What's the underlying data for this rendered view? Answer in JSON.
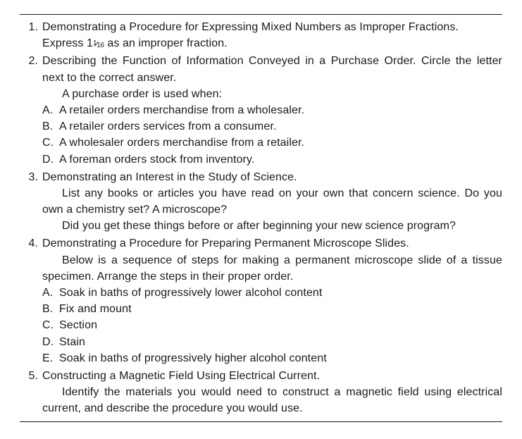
{
  "items": [
    {
      "num": "1.",
      "title": "Demonstrating a Procedure for Expressing Mixed Numbers as Improper Fractions.",
      "lines": [
        "Express 1 1/16 as an improper fraction."
      ],
      "fraction_display": {
        "whole": "1",
        "num": "1",
        "den": "16"
      }
    },
    {
      "num": "2.",
      "title": "Describing the Function of Information Conveyed in a Purchase Order. Circle the letter next to the correct answer.",
      "stem": "A purchase order is used when:",
      "choices": [
        {
          "label": "A.",
          "text": "A retailer orders merchandise from a wholesaler."
        },
        {
          "label": "B.",
          "text": "A retailer orders services from a consumer."
        },
        {
          "label": "C.",
          "text": "A wholesaler orders merchandise from a retailer."
        },
        {
          "label": "D.",
          "text": "A foreman orders stock from inventory."
        }
      ]
    },
    {
      "num": "3.",
      "title": "Demonstrating an Interest in the Study of Science.",
      "paragraphs": [
        "List any books or articles you have read on your own that concern science. Do you own a chemistry set? A microscope?",
        "Did you get these things before or after beginning your new science program?"
      ]
    },
    {
      "num": "4.",
      "title": "Demonstrating a Procedure for Preparing Permanent Microscope Slides.",
      "stem_paragraph": "Below is a sequence of steps for making a permanent microscope slide of a tissue specimen. Arrange the steps in their proper order.",
      "choices": [
        {
          "label": "A.",
          "text": "Soak in baths of progressively lower alcohol content"
        },
        {
          "label": "B.",
          "text": "Fix and mount"
        },
        {
          "label": "C.",
          "text": "Section"
        },
        {
          "label": "D.",
          "text": "Stain"
        },
        {
          "label": "E.",
          "text": "Soak in baths of progressively higher alcohol content"
        }
      ]
    },
    {
      "num": "5.",
      "title": "Constructing a Magnetic Field Using Electrical Current.",
      "paragraphs": [
        "Identify the materials you would need to construct a magnetic field using electrical current, and describe the procedure you would use."
      ]
    }
  ],
  "frac_prefix": "Express ",
  "frac_suffix": " as an improper fraction."
}
